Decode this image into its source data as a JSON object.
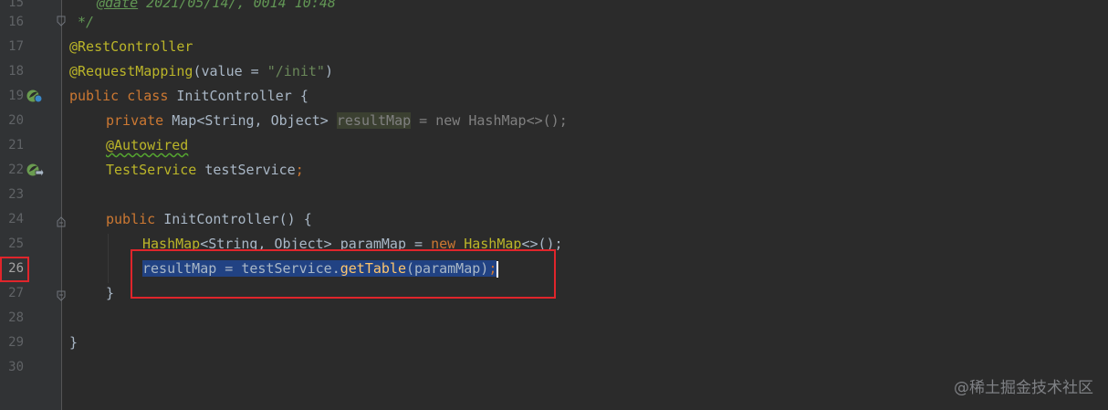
{
  "editor": {
    "line_numbers": [
      "15",
      "16",
      "17",
      "18",
      "19",
      "20",
      "21",
      "22",
      "23",
      "24",
      "25",
      "26",
      "27",
      "28",
      "29",
      "30"
    ],
    "current_line": "26",
    "lines": {
      "l15_tag": "@date",
      "l15_rest": " 2021/05/14/, 0014 10:48",
      "l16": " */",
      "l17": "@RestController",
      "l18_ann": "@RequestMapping",
      "l18_paren": "(value = ",
      "l18_str": "\"/init\"",
      "l18_close": ")",
      "l19_kw": "public class",
      "l19_rest": " InitController {",
      "l20_kw": "private",
      "l20_type": " Map<String, Object> ",
      "l20_field": "resultMap",
      "l20_rest": " = new HashMap<>();",
      "l21": "@Autowired",
      "l22_type": "TestService",
      "l22_field": " testService",
      "l22_end": ";",
      "l24_kw": "public",
      "l24_name": " InitController",
      "l24_rest": "() {",
      "l25_a": "HashMap",
      "l25_b": "<String, Object> ",
      "l25_c": "paramMap",
      "l25_d": " = ",
      "l25_e": "new",
      "l25_f": " HashMap",
      "l25_g": "<>();",
      "l26_a": "resultMap",
      "l26_b": " = ",
      "l26_c": "testService",
      "l26_d": ".",
      "l26_e": "getTable",
      "l26_f": "(paramMap)",
      "l26_g": ";",
      "l27": "}",
      "l29": "}"
    },
    "icons": [
      "spring-bean-icon",
      "spring-bean-autowired-icon",
      "fold-marker-icon"
    ]
  },
  "watermark": "@稀土掘金技术社区",
  "colors": {
    "background": "#2b2b2b",
    "gutter": "#313335",
    "keyword": "#cc7832",
    "annotation": "#bbb529",
    "string": "#6a8759",
    "selection": "#214283",
    "highlight_box": "#e0252b"
  }
}
